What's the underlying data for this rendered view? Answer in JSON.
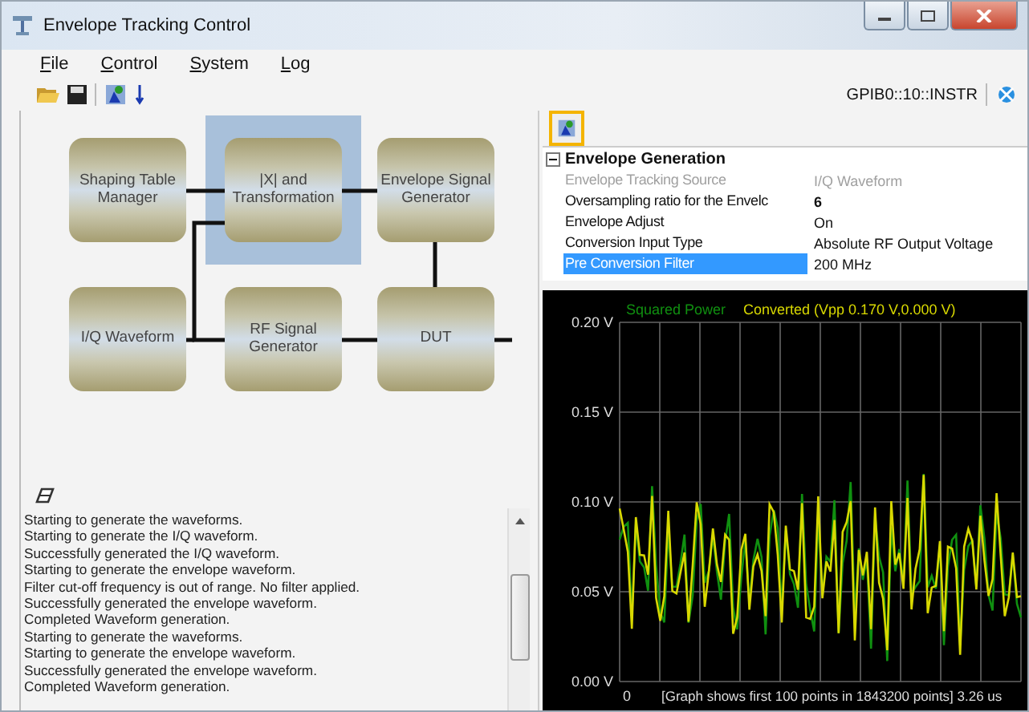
{
  "window": {
    "title": "Envelope Tracking Control"
  },
  "menu": [
    {
      "label": "File"
    },
    {
      "label": "Control"
    },
    {
      "label": "System"
    },
    {
      "label": "Log"
    }
  ],
  "toolbar": {
    "instrument": "GPIB0::10::INSTR"
  },
  "diagram": {
    "nodes": [
      {
        "label": "Shaping Table Manager",
        "selected": false
      },
      {
        "label": "|X| and Transformation",
        "selected": true
      },
      {
        "label": "Envelope Signal Generator",
        "selected": false
      },
      {
        "label": "I/Q Waveform",
        "selected": false
      },
      {
        "label": "RF Signal Generator",
        "selected": false
      },
      {
        "label": "DUT",
        "selected": false
      }
    ]
  },
  "log": {
    "lines": [
      "Starting to generate the waveforms.",
      "Starting to generate the I/Q waveform.",
      "Successfully generated the I/Q waveform.",
      "Starting to generate the envelope waveform.",
      "Filter cut-off frequency is out of range. No filter applied.",
      "Successfully generated the envelope waveform.",
      "Completed Waveform generation.",
      "Starting to generate the waveforms.",
      "Starting to generate the envelope waveform.",
      "Successfully generated the envelope waveform.",
      "Completed Waveform generation."
    ]
  },
  "properties": {
    "category": "Envelope Generation",
    "expanded": true,
    "rows": [
      {
        "name": "Envelope Tracking Source",
        "value": "I/Q Waveform",
        "disabled": true,
        "modified": false,
        "selected": false
      },
      {
        "name": "Oversampling ratio for the Envelc",
        "value": "6",
        "disabled": false,
        "modified": true,
        "selected": false
      },
      {
        "name": "Envelope Adjust",
        "value": "On",
        "disabled": false,
        "modified": false,
        "selected": false
      },
      {
        "name": "Conversion Input Type",
        "value": "Absolute RF Output Voltage",
        "disabled": false,
        "modified": false,
        "selected": false
      },
      {
        "name": "Pre Conversion Filter",
        "value": "200 MHz",
        "disabled": false,
        "modified": false,
        "selected": true
      }
    ]
  },
  "graph": {
    "legend": [
      {
        "label": "Squared Power",
        "color": "#109010"
      },
      {
        "label": "Converted (Vpp 0.170 V,0.000 V)",
        "color": "#d8d800"
      }
    ],
    "y_axis_labels": [
      "0.20 V",
      "0.15 V",
      "0.10 V",
      "0.05 V",
      "0.00 V"
    ],
    "x_start": "0",
    "footer": "[Graph shows first 100 points in 1843200 points] 3.26 us"
  }
}
